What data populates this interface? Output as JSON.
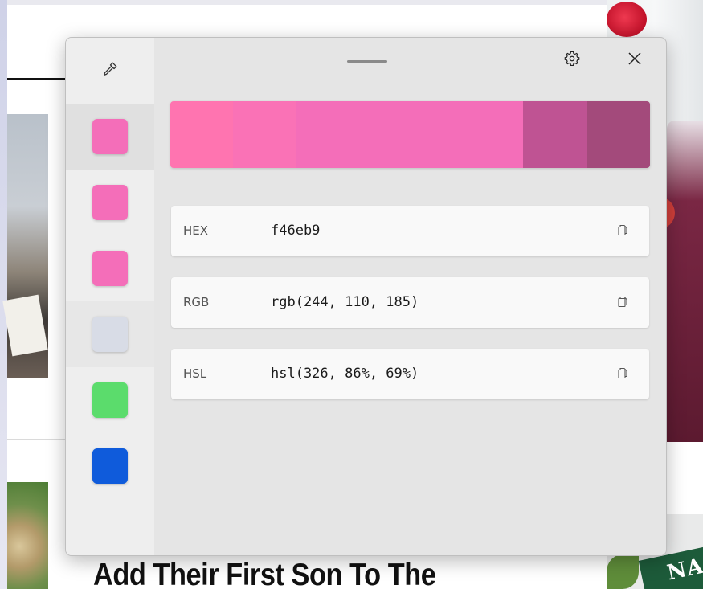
{
  "background": {
    "headline": "Add Their First Son To The",
    "badge_text": "NA"
  },
  "picker": {
    "toolbar": {
      "eyedropper_icon": "eyedropper-icon",
      "settings_icon": "gear-icon",
      "close_icon": "close-icon"
    },
    "history": [
      {
        "color": "#f46eb9",
        "selected": true
      },
      {
        "color": "#f46eb9",
        "selected": false
      },
      {
        "color": "#f46eb9",
        "selected": false
      },
      {
        "color": "#d8dce6",
        "selected": false
      },
      {
        "color": "#5bdc6c",
        "selected": false
      },
      {
        "color": "#0f5bdb",
        "selected": false
      }
    ],
    "shades": [
      {
        "color": "#ff74b0"
      },
      {
        "color": "#fa72b6"
      },
      {
        "color": "#f46eb9"
      },
      {
        "color": "#bf5393"
      },
      {
        "color": "#a34a7b"
      }
    ],
    "formats": [
      {
        "label": "HEX",
        "value": "f46eb9"
      },
      {
        "label": "RGB",
        "value": "rgb(244, 110, 185)"
      },
      {
        "label": "HSL",
        "value": "hsl(326, 86%, 69%)"
      }
    ]
  }
}
